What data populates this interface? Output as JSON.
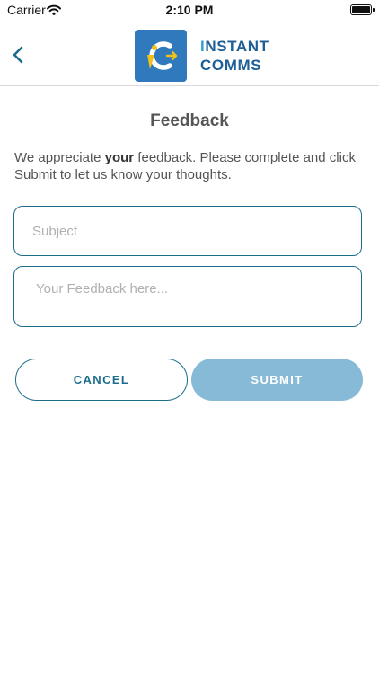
{
  "status_bar": {
    "carrier": "Carrier",
    "time": "2:10 PM"
  },
  "header": {
    "brand_line1_initial": "I",
    "brand_line1_rest": "NSTANT",
    "brand_line2": "COMMS",
    "logo_letters": "iC"
  },
  "page": {
    "title": "Feedback",
    "intro_before": "We appreciate ",
    "intro_bold": "your",
    "intro_after": " feedback. Please complete and click Submit to let us know your thoughts."
  },
  "form": {
    "subject_placeholder": "Subject",
    "subject_value": "",
    "feedback_placeholder": "Your Feedback here...",
    "feedback_value": ""
  },
  "buttons": {
    "cancel_label": "CANCEL",
    "submit_label": "SUBMIT"
  },
  "colors": {
    "accent": "#1c6d8c",
    "submit_disabled": "#86bad6",
    "logo_bg": "#2f79bc",
    "logo_yellow": "#f2c21b"
  },
  "icons": {
    "back": "chevron-left-icon",
    "wifi": "wifi-icon",
    "battery": "battery-icon"
  }
}
